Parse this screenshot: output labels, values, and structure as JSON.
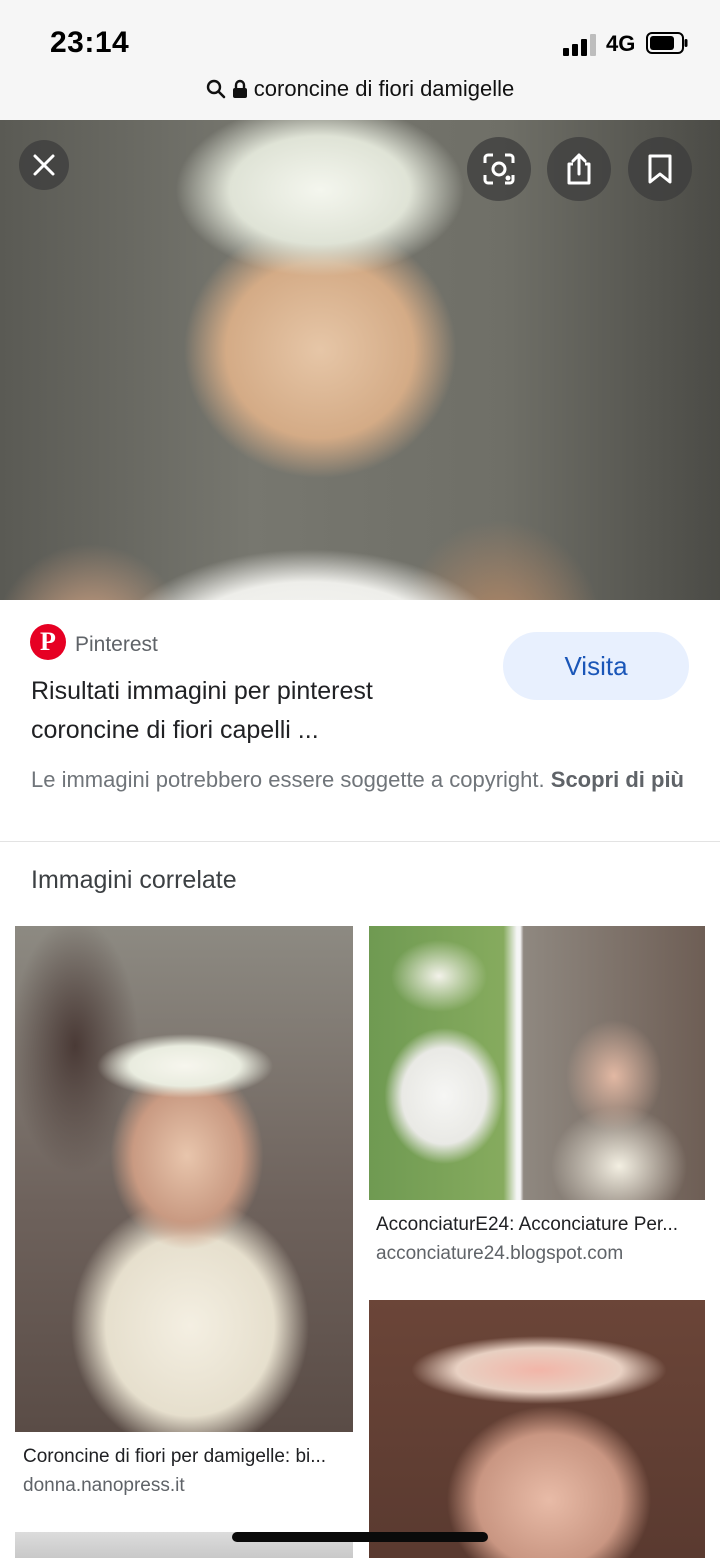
{
  "status": {
    "time": "23:14",
    "network": "4G"
  },
  "urlbar": {
    "query": "coroncine di fiori damigelle"
  },
  "source": {
    "name": "Pinterest",
    "title": "Risultati immagini per pinterest coroncine di fiori capelli ...",
    "visit_label": "Visita",
    "copyright": "Le immagini potrebbero essere soggette a copyright.",
    "learn_more": "Scopri di più"
  },
  "related": {
    "heading": "Immagini correlate",
    "items": [
      {
        "caption": "Coroncine di fiori per damigelle: bi...",
        "domain": "donna.nanopress.it"
      },
      {
        "caption": "AcconciaturE24: Acconciature Per...",
        "domain": "acconciature24.blogspot.com"
      }
    ]
  },
  "colors": {
    "accent": "#1a56b8",
    "visit_bg": "#e8f0fe",
    "pinterest": "#e60023"
  }
}
